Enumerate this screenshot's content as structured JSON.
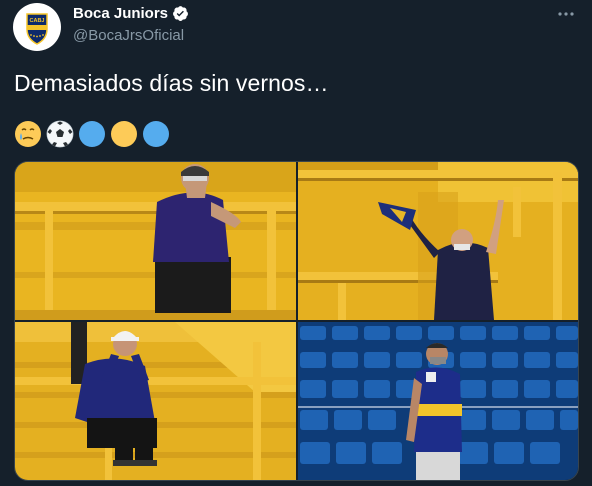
{
  "account": {
    "display_name": "Boca Juniors",
    "handle": "@BocaJrsOficial",
    "avatar_text": "CABJ",
    "verified": true
  },
  "tweet": {
    "text": "Demasiados días sin vernos…"
  },
  "emojis": [
    {
      "name": "face-holding-back-tears-emoji"
    },
    {
      "name": "soccer-ball-emoji"
    },
    {
      "name": "blue-circle-emoji",
      "color": "#55acee"
    },
    {
      "name": "yellow-circle-emoji",
      "color": "#fdcb58"
    },
    {
      "name": "blue-circle-emoji",
      "color": "#55acee"
    }
  ],
  "photos": [
    {
      "name": "fan-crying-at-railing-photo"
    },
    {
      "name": "fan-waving-scarf-photo"
    },
    {
      "name": "fan-sitting-with-head-in-hands-photo"
    },
    {
      "name": "fan-standing-among-empty-seats-photo"
    }
  ],
  "colors": {
    "background": "#15202b",
    "secondary_text": "#8899a6",
    "verified_blue": "#ffffff",
    "boca_blue": "#1a2b6d",
    "boca_yellow": "#f5c52a"
  }
}
